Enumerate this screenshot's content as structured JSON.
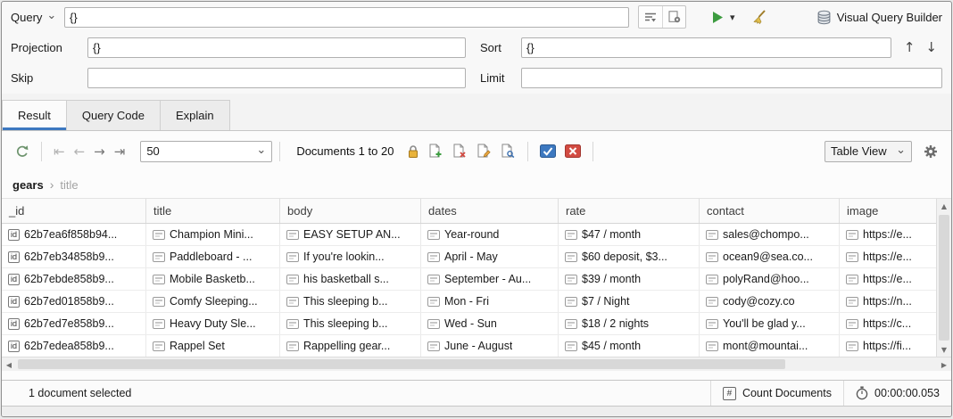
{
  "colors": {
    "accent_blue": "#3c78c0",
    "play_green": "#3d9c40",
    "alert_red": "#d24b42",
    "lock_gold": "#e9b33b"
  },
  "glyphs": {
    "chevron_down": "⌄",
    "dropdown_arrow": "▾",
    "first_page": "⇤",
    "prev_page": "←",
    "next_page": "→",
    "last_page": "⇥",
    "sort_asc": "↑",
    "sort_desc": "↓",
    "breadcrumb_sep": "›",
    "scroll_up": "▲",
    "scroll_down": "▼",
    "scroll_left": "◀",
    "scroll_right": "▶",
    "hash": "#"
  },
  "query_panel": {
    "query_label": "Query",
    "query_value": "{}",
    "projection_label": "Projection",
    "projection_value": "{}",
    "sort_label": "Sort",
    "sort_value": "{}",
    "skip_label": "Skip",
    "skip_value": "",
    "limit_label": "Limit",
    "limit_value": "",
    "visual_query_builder_label": "Visual Query Builder"
  },
  "tabs": {
    "result": "Result",
    "query_code": "Query Code",
    "explain": "Explain"
  },
  "toolbar": {
    "page_size": "50",
    "documents_range": "Documents 1 to 20",
    "view_mode": "Table View"
  },
  "breadcrumb": {
    "collection": "gears",
    "field": "title"
  },
  "table": {
    "id_badge": "id",
    "columns": [
      "_id",
      "title",
      "body",
      "dates",
      "rate",
      "contact",
      "image"
    ],
    "rows": [
      {
        "cells": [
          "62b7ea6f858b94...",
          "Champion Mini...",
          "EASY SETUP AN...",
          "Year-round",
          "$47 / month",
          "sales@chompo...",
          "https://e..."
        ]
      },
      {
        "cells": [
          "62b7eb34858b9...",
          "Paddleboard - ...",
          "If you're lookin...",
          "April - May",
          "$60 deposit, $3...",
          "ocean9@sea.co...",
          "https://e..."
        ]
      },
      {
        "cells": [
          "62b7ebde858b9...",
          "Mobile Basketb...",
          "his basketball s...",
          "September - Au...",
          "$39 / month",
          "polyRand@hoo...",
          "https://e..."
        ]
      },
      {
        "cells": [
          "62b7ed01858b9...",
          "Comfy Sleeping...",
          "This sleeping b...",
          "Mon - Fri",
          "$7 / Night",
          "cody@cozy.co",
          "https://n..."
        ]
      },
      {
        "cells": [
          "62b7ed7e858b9...",
          "Heavy Duty Sle...",
          "This sleeping b...",
          "Wed - Sun",
          "$18 / 2 nights",
          "You'll be glad y...",
          "https://c..."
        ]
      },
      {
        "cells": [
          "62b7edea858b9...",
          "Rappel Set",
          "Rappelling gear...",
          "June - August",
          "$45 / month",
          "mont@mountai...",
          "https://fi..."
        ]
      }
    ]
  },
  "status_bar": {
    "selection": "1 document selected",
    "count_documents": "Count Documents",
    "elapsed": "00:00:00.053"
  }
}
